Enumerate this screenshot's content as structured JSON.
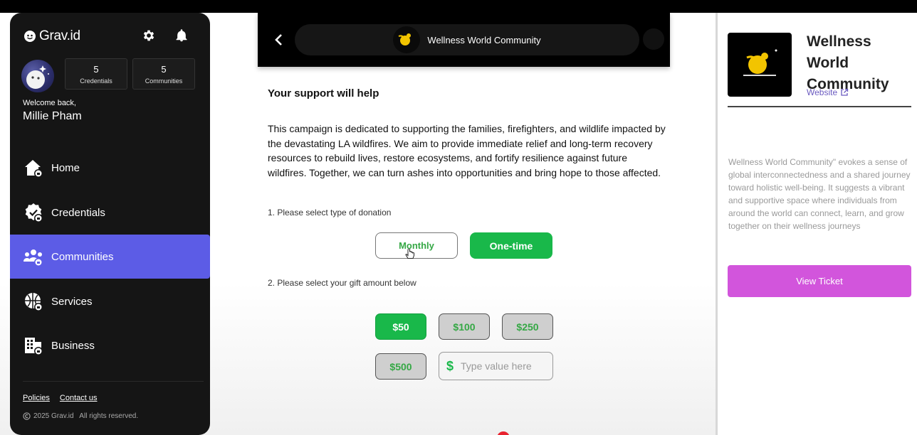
{
  "app": {
    "logo_text": "Grav.id"
  },
  "sidebar": {
    "stats": [
      {
        "value": "5",
        "label": "Credentials"
      },
      {
        "value": "5",
        "label": "Communities"
      }
    ],
    "welcome": "Welcome back,",
    "user_name": "Millie Pham",
    "nav": [
      {
        "label": "Home",
        "icon": "home-icon",
        "active": false
      },
      {
        "label": "Credentials",
        "icon": "credentials-icon",
        "active": true
      },
      {
        "label": "Communities",
        "icon": "communities-icon",
        "active": true
      },
      {
        "label": "Services",
        "icon": "services-icon",
        "active": false
      },
      {
        "label": "Business",
        "icon": "business-icon",
        "active": false
      }
    ],
    "footer": {
      "policies": "Policies",
      "contact": "Contact us",
      "copyright": "2025 Grav.id   All rights reserved."
    }
  },
  "header": {
    "title": "Wellness World Community"
  },
  "content": {
    "section_title": "Your support will help",
    "description": "This campaign is dedicated to supporting the families, firefighters, and wildlife impacted by the devastating LA wildfires. We aim to provide immediate relief and long-term recovery resources to rebuild lives, restore ecosystems, and fortify resilience against future wildfires. Together, we can turn ashes into opportunities and bring hope to those affected.",
    "step1": "1. Please select type of donation",
    "donation_types": [
      "Monthly",
      "One-time"
    ],
    "selected_donation_type": "One-time",
    "step2": "2. Please select your gift amount below",
    "amounts": [
      "$50",
      "$100",
      "$250",
      "$500"
    ],
    "selected_amount": "$50",
    "custom_symbol": "$",
    "custom_placeholder": "Type value here"
  },
  "right_panel": {
    "title": "Wellness World Community",
    "website_label": "Website",
    "description": "Wellness World Community\" evokes a sense of global interconnectedness and a shared journey toward holistic well-being. It suggests a vibrant and supportive space where individuals from around the world can connect, learn, and grow together on their wellness journeys",
    "button": "View Ticket"
  },
  "colors": {
    "accent_purple": "#5c5ce6",
    "green": "#19b84a",
    "ticket_pink": "#d255dc",
    "sidebar_bg": "#151515"
  }
}
